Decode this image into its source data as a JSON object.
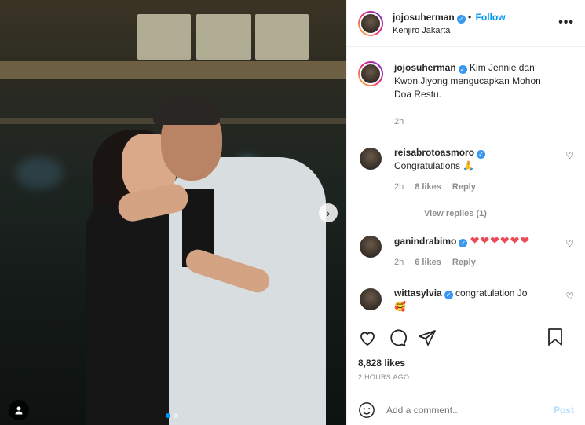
{
  "post": {
    "author": "jojosuherman",
    "follow_label": "Follow",
    "location": "Kenjiro Jakarta",
    "more_label": "•••",
    "caption": "Kim Jennie dan Kwon Jiyong mengucapkan Mohon Doa Restu.",
    "caption_time": "2h",
    "likes": "8,828 likes",
    "posted": "2 HOURS AGO",
    "carousel": {
      "current": 1,
      "total": 2
    }
  },
  "comments": [
    {
      "user": "reisabrotoasmoro",
      "text": "Congratulations",
      "emoji": "🙏",
      "time": "2h",
      "likes": "8 likes",
      "reply": "Reply",
      "view_replies": "View replies (1)"
    },
    {
      "user": "ganindrabimo",
      "text": "",
      "hearts": "❤❤❤❤❤❤",
      "time": "2h",
      "likes": "6 likes",
      "reply": "Reply"
    },
    {
      "user": "wittasylvia",
      "text": "congratulation Jo",
      "emoji": "🥰"
    }
  ],
  "add_comment": {
    "placeholder": "Add a comment...",
    "post_label": "Post"
  },
  "colors": {
    "accent": "#0095f6",
    "verified": "#3897f0",
    "heart": "#ed4956"
  },
  "icons": [
    "verified-badge-icon",
    "more-options-icon",
    "heart-icon",
    "comment-icon",
    "share-icon",
    "bookmark-icon",
    "emoji-icon",
    "next-icon",
    "user-tag-icon"
  ]
}
